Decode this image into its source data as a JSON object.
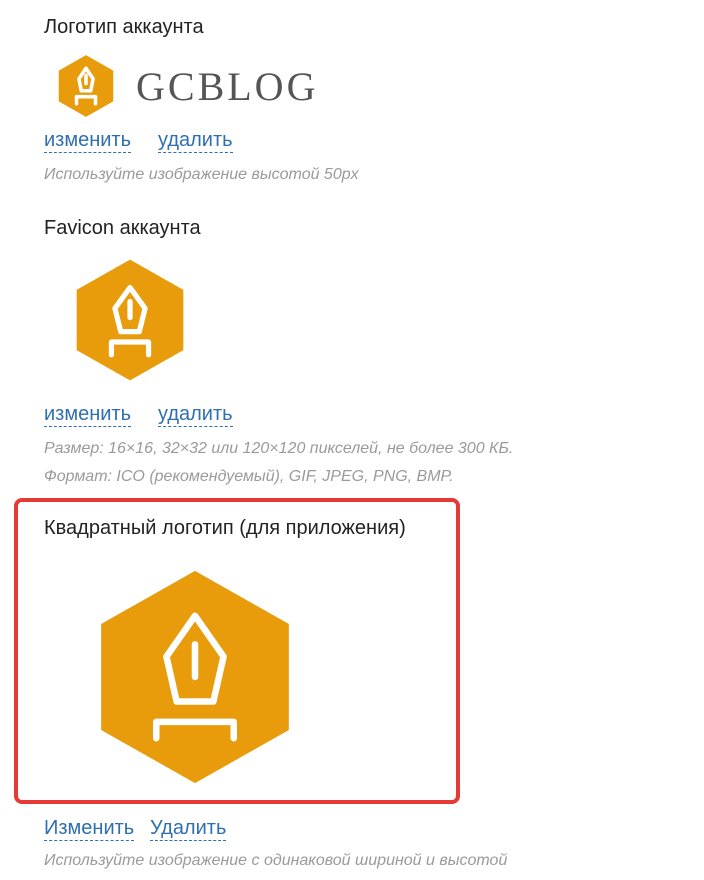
{
  "colors": {
    "accent": "#e89c0c",
    "link": "#2f6fb1",
    "highlight": "#e53935",
    "hint": "#9a9a9a"
  },
  "account_logo": {
    "title": "Логотип аккаунта",
    "brand_text": "GCBLOG",
    "change_label": "изменить",
    "delete_label": "удалить",
    "hint": "Используйте изображение высотой 50px"
  },
  "favicon": {
    "title": "Favicon аккаунта",
    "change_label": "изменить",
    "delete_label": "удалить",
    "hint_size": "Размер: 16×16, 32×32 или 120×120 пикселей, не более 300 КБ.",
    "hint_format": "Формат: ICO (рекомендуемый), GIF, JPEG, PNG, BMP."
  },
  "square_logo": {
    "title": "Квадратный логотип (для приложения)",
    "change_label": "Изменить",
    "delete_label": "Удалить",
    "hint": "Используйте изображение с одинаковой шириной и высотой"
  }
}
